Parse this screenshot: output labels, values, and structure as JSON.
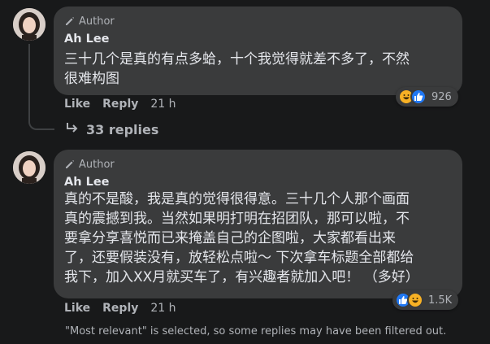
{
  "comments": [
    {
      "badge": "Author",
      "name": "Ah Lee",
      "text": "三十几个是真的有点多蛤，十个我觉得就差不多了，不然\n很难构图",
      "like_label": "Like",
      "reply_label": "Reply",
      "time": "21 h",
      "reaction_count": "926",
      "reaction_icons": [
        "haha-emoji",
        "like-thumb"
      ]
    },
    {
      "badge": "Author",
      "name": "Ah Lee",
      "text": "真的不是酸，我是真的觉得很得意。三十几个人那个画面\n真的震撼到我。当然如果明打明在招团队，那可以啦，不\n要拿分享喜悦而已来掩盖自己的企图啦，大家都看出来\n了，还要假装没有，放轻松点啦～ 下次拿车标题全部都给\n我下，加入XX月就买车了，有兴趣者就加入吧！ （多好）",
      "like_label": "Like",
      "reply_label": "Reply",
      "time": "21 h",
      "reaction_count": "1.5K",
      "reaction_icons": [
        "like-thumb",
        "haha-emoji"
      ]
    }
  ],
  "replies_link": "33 replies",
  "filter_note": "\"Most relevant\" is selected, so some replies may have been filtered out.",
  "colors": {
    "background": "#18191a",
    "bubble": "#3a3b3c",
    "text": "#e4e6eb",
    "secondary_text": "#b0b3b8",
    "like_blue": "#2078f4",
    "haha_yellow": "#f7b125"
  }
}
